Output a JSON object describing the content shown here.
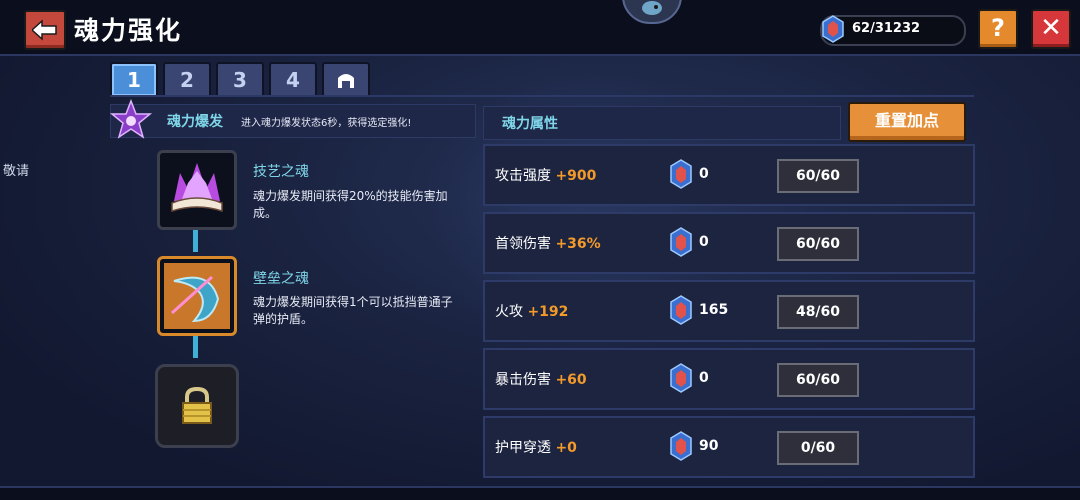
{
  "header": {
    "title": "魂力强化",
    "currency_amount": "62/31232",
    "help_label": "?",
    "close_label": "✕"
  },
  "side_text": "敬请",
  "tabs": [
    {
      "label": "1",
      "active": true
    },
    {
      "label": "2",
      "active": false
    },
    {
      "label": "3",
      "active": false
    },
    {
      "label": "4",
      "active": false
    },
    {
      "label": "",
      "icon": "arch-icon",
      "active": false
    }
  ],
  "burst": {
    "title": "魂力爆发",
    "description": "进入魂力爆发状态6秒，获得选定强化!"
  },
  "skills": [
    {
      "title": "技艺之魂",
      "description": "魂力爆发期间获得20%的技能伤害加成。",
      "icon": "purple-flame-book-icon"
    },
    {
      "title": "壁垒之魂",
      "description": "魂力爆发期间获得1个可以抵挡普通子弹的护盾。",
      "icon": "shield-crescent-icon"
    },
    {
      "title": "",
      "description": "",
      "icon": "lock-icon",
      "locked": true
    }
  ],
  "attributes": {
    "title": "魂力属性",
    "reset_label": "重置加点",
    "rows": [
      {
        "name": "攻击强度",
        "bonus": "+900",
        "count": "0",
        "level": "60/60"
      },
      {
        "name": "首领伤害",
        "bonus": "+36%",
        "count": "0",
        "level": "60/60"
      },
      {
        "name": "火攻",
        "bonus": "+192",
        "count": "165",
        "level": "48/60"
      },
      {
        "name": "暴击伤害",
        "bonus": "+60",
        "count": "0",
        "level": "60/60"
      },
      {
        "name": "护甲穿透",
        "bonus": "+0",
        "count": "90",
        "level": "0/60"
      }
    ]
  },
  "colors": {
    "accent_cyan": "#7fd6e8",
    "bonus_orange": "#f39a2b",
    "tab_active": "#4a8fd8",
    "reset_button": "#e6913a"
  }
}
